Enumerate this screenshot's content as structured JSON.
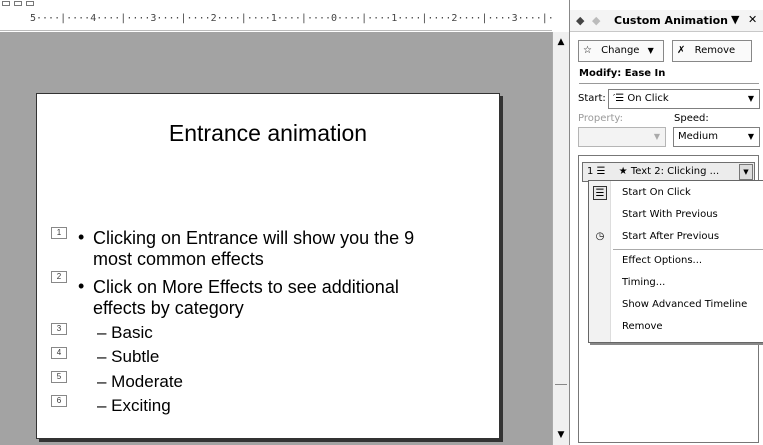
{
  "ruler": {
    "text": "5····|····4····|····3····|····2····|····1····|····0····|····1····|····2····|····3····|····4····|····"
  },
  "slide": {
    "title": "Entrance animation",
    "items": [
      {
        "num": "1",
        "bullet": "•",
        "lines": [
          "Clicking on Entrance will show you the 9",
          "most common effects"
        ]
      },
      {
        "num": "2",
        "bullet": "•",
        "lines": [
          "Click on More Effects to see additional",
          "effects by category"
        ]
      },
      {
        "num": "3",
        "text": "– Basic"
      },
      {
        "num": "4",
        "text": "– Subtle"
      },
      {
        "num": "5",
        "text": "– Moderate"
      },
      {
        "num": "6",
        "text": "– Exciting"
      }
    ]
  },
  "scrollbar": {
    "up": "▲",
    "down": "▼"
  },
  "pane": {
    "back": "◆",
    "forward": "◆",
    "title": "Custom Animation",
    "menu_arrow": "▼",
    "close": "✕",
    "change_label": "Change",
    "change_icon": "☆",
    "remove_label": "Remove",
    "remove_icon": "✗",
    "modify_label": "Modify: Ease In",
    "start_label": "Start:",
    "start_value": "′☰ On Click",
    "property_label": "Property:",
    "speed_label": "Speed:",
    "property_value": "",
    "speed_value": "Medium",
    "dropdown_arrow": "▼",
    "list_item": "1 ☰  ★ Text 2: Clicking ..."
  },
  "context_menu": {
    "items": [
      {
        "label": "Start On Click",
        "icon": "☰",
        "checked": true
      },
      {
        "label": "Start With Previous",
        "icon": ""
      },
      {
        "label": "Start After Previous",
        "icon": "◷"
      },
      {
        "label": "Effect Options...",
        "icon": ""
      },
      {
        "label": "Timing...",
        "icon": ""
      },
      {
        "label": "Show Advanced Timeline",
        "icon": ""
      },
      {
        "label": "Remove",
        "icon": ""
      }
    ]
  },
  "icons": {
    "up_arrow": "▲",
    "down_arrow": "▼"
  }
}
